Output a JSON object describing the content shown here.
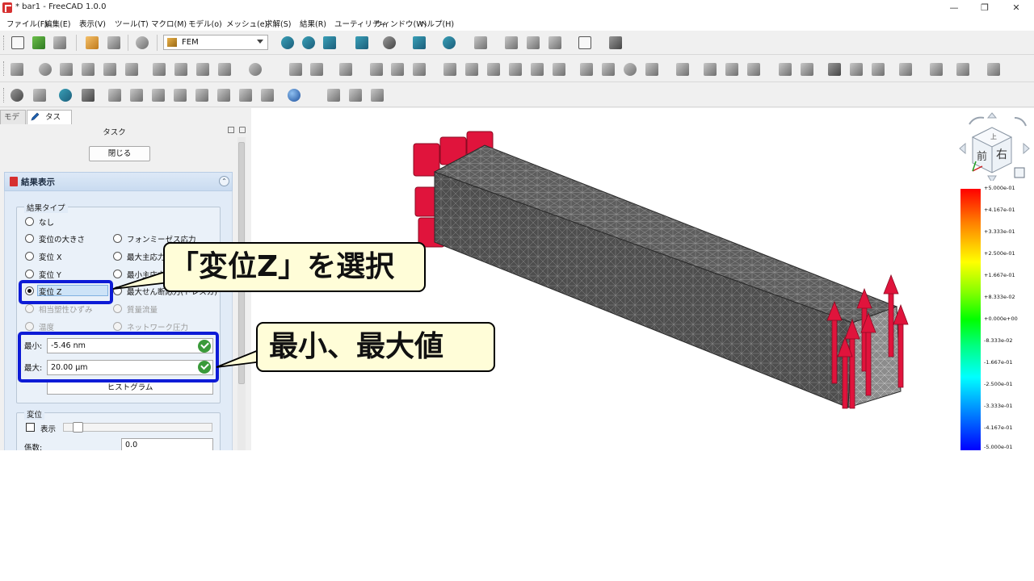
{
  "window": {
    "title": "* bar1 - FreeCAD 1.0.0",
    "minimize": "—",
    "maximize": "❐",
    "close": "✕"
  },
  "menu": [
    "ファイル(F)",
    "編集(E)",
    "表示(V)",
    "ツール(T)",
    "マクロ(M)",
    "モデル(o)",
    "メッシュ(e)",
    "求解(S)",
    "結果(R)",
    "ユーティリティ",
    "ウィンドウ(W)",
    "ヘルプ(H)"
  ],
  "toolbar": {
    "workbench": "FEM"
  },
  "tabs": {
    "model": "モデル",
    "task": "タスク"
  },
  "panel": {
    "title": "タスク",
    "close_button": "閉じる",
    "result_title": "結果表示",
    "collapse": "⌃"
  },
  "result_type": {
    "group_label": "結果タイプ",
    "options": [
      {
        "label": "なし",
        "checked": false,
        "enabled": true
      },
      {
        "label": "変位の大きさ",
        "checked": false,
        "enabled": true
      },
      {
        "label": "フォンミーゼス応力",
        "checked": false,
        "enabled": true
      },
      {
        "label": "変位 X",
        "checked": false,
        "enabled": true
      },
      {
        "label": "最大主応力",
        "checked": false,
        "enabled": true
      },
      {
        "label": "変位 Y",
        "checked": false,
        "enabled": true
      },
      {
        "label": "最小主応力",
        "checked": false,
        "enabled": true
      },
      {
        "label": "変位 Z",
        "checked": true,
        "enabled": true
      },
      {
        "label": "最大せん断応力(トレスカ)",
        "checked": false,
        "enabled": true
      },
      {
        "label": "相当塑性ひずみ",
        "checked": false,
        "enabled": false
      },
      {
        "label": "質量流量",
        "checked": false,
        "enabled": false
      },
      {
        "label": "温度",
        "checked": false,
        "enabled": false
      },
      {
        "label": "ネットワーク圧力",
        "checked": false,
        "enabled": false
      }
    ],
    "min_label": "最小:",
    "min_value": "-5.46 nm",
    "max_label": "最大:",
    "max_value": "20.00 µm",
    "histogram_button": "ヒストグラム"
  },
  "displacement": {
    "group_label": "変位",
    "show_label": "表示",
    "show_checked": false,
    "factor_label": "係数:",
    "factor_value": "0.0"
  },
  "nav_cube": {
    "front": "前",
    "right": "右",
    "top": "上"
  },
  "legend": {
    "labels": [
      "+5.000e-01",
      "+4.167e-01",
      "+3.333e-01",
      "+2.500e-01",
      "+1.667e-01",
      "+8.333e-02",
      "+0.000e+00",
      "-8.333e-02",
      "-1.667e-01",
      "-2.500e-01",
      "-3.333e-01",
      "-4.167e-01",
      "-5.000e-01"
    ]
  },
  "annotations": {
    "select_z": "「変位Z」を選択",
    "min_max": "最小、最大値"
  },
  "colors": {
    "highlight": "#0d1bd6",
    "callout_bg": "#fffdd8",
    "constraint": "#e0143c",
    "mesh": "#5a5a5a"
  }
}
